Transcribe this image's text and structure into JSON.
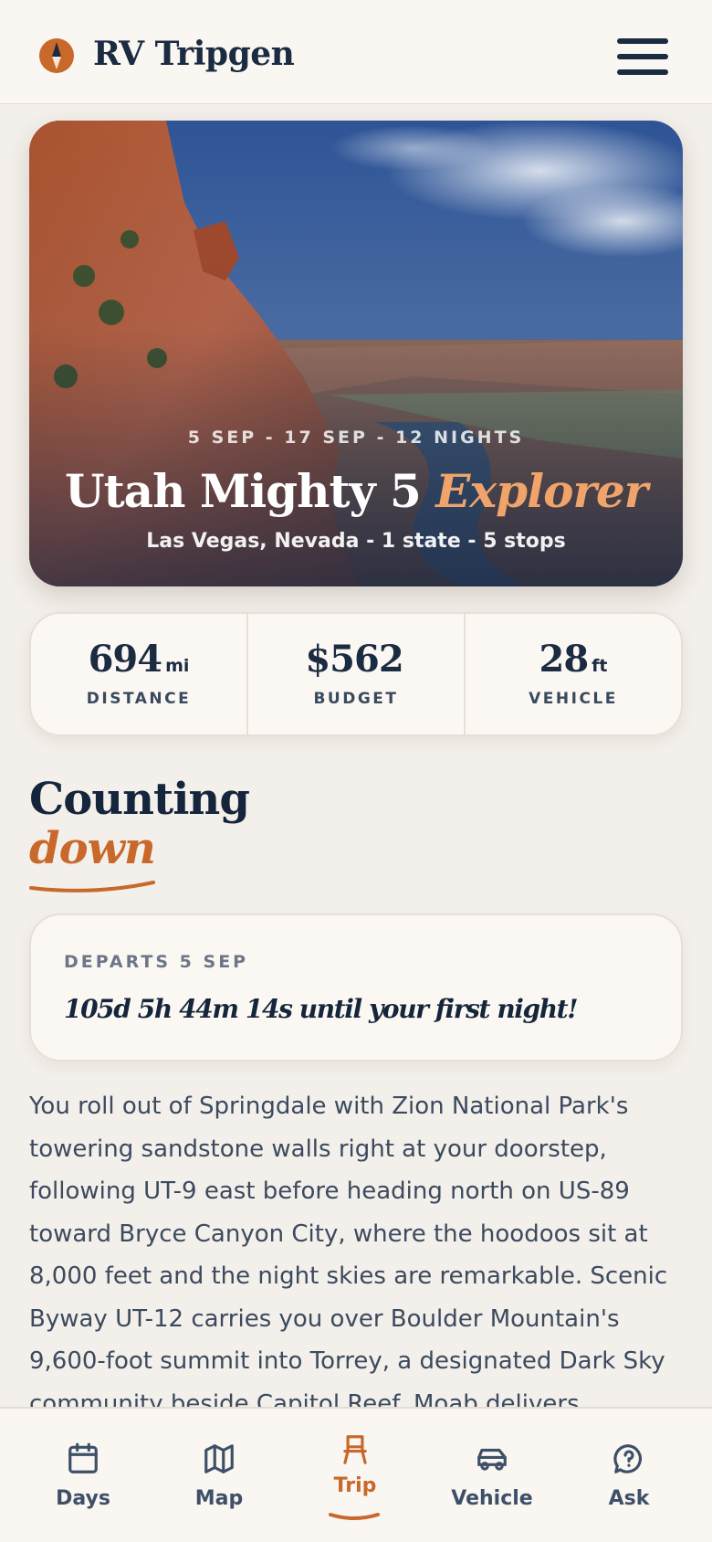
{
  "app": {
    "brand": "RV Tripgen",
    "logo_icon": "compass-icon",
    "menu_icon": "hamburger-menu-icon",
    "accent_color": "#c8682a",
    "navy_color": "#1a2b42"
  },
  "hero": {
    "dates": "5 SEP - 17 SEP - 12 NIGHTS",
    "title": "Utah Mighty 5",
    "title_accent": "Explorer",
    "subtitle": "Las Vegas, Nevada - 1 state - 5 stops"
  },
  "stats": [
    {
      "value": "694",
      "unit": "mi",
      "label": "DISTANCE"
    },
    {
      "value": "$562",
      "unit": "",
      "label": "BUDGET"
    },
    {
      "value": "28",
      "unit": "ft",
      "label": "VEHICLE"
    }
  ],
  "countdown_section": {
    "title": "Counting",
    "title_accent": "down",
    "depart_label": "DEPARTS 5 SEP",
    "countdown_text": "105d 5h 44m 14s until your first night!"
  },
  "description": "You roll out of Springdale with Zion National Park's towering sandstone walls right at your doorstep, following UT-9 east before heading north on US-89 toward Bryce Canyon City, where the hoodoos sit at 8,000 feet and the night skies are remarkable. Scenic Byway UT-12 carries you over Boulder Mountain's 9,600-foot summit into Torrey, a designated Dark Sky community beside Capitol Reef. Moab delivers",
  "nav": [
    {
      "label": "Days",
      "icon": "calendar-icon",
      "active": false
    },
    {
      "label": "Map",
      "icon": "map-icon",
      "active": false
    },
    {
      "label": "Trip",
      "icon": "camp-chair-icon",
      "active": true
    },
    {
      "label": "Vehicle",
      "icon": "car-icon",
      "active": false
    },
    {
      "label": "Ask",
      "icon": "question-chat-icon",
      "active": false
    }
  ]
}
